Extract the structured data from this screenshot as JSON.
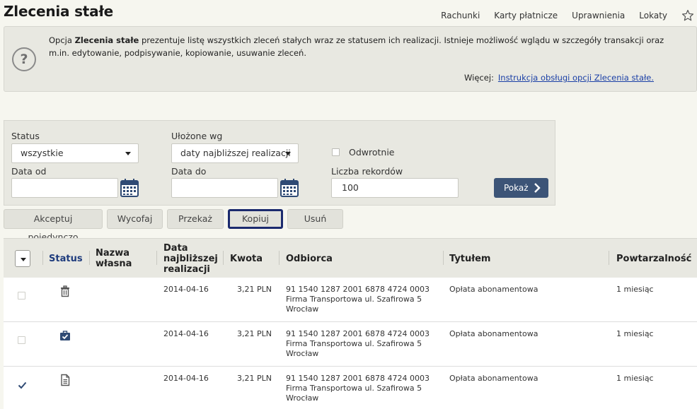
{
  "page": {
    "title": "Zlecenia stałe"
  },
  "nav": {
    "items": [
      "Rachunki",
      "Karty płatnicze",
      "Uprawnienia",
      "Lokaty"
    ],
    "favorite_icon": "star-icon"
  },
  "info": {
    "prefix": "Opcja ",
    "bold": "Zlecenia stałe",
    "text": " prezentuje listę wszystkich zleceń stałych wraz ze statusem ich realizacji. Istnieje możliwość wglądu w szczegóły transakcji oraz m.in. edytowanie, podpisywanie, kopiowanie, usuwanie zleceń.",
    "more_label": "Więcej:",
    "more_link": "Instrukcja obsługi opcji Zlecenia stałe."
  },
  "filters": {
    "status_label": "Status",
    "status_value": "wszystkie",
    "sort_label": "Ułożone wg",
    "sort_value": "daty najbliższej realizacji",
    "reverse_label": "Odwrotnie",
    "date_from_label": "Data od",
    "date_from_value": "",
    "date_to_label": "Data do",
    "date_to_value": "",
    "records_label": "Liczba rekordów",
    "records_value": "100",
    "show_button": "Pokaż"
  },
  "actions": [
    "Akceptuj pojedynczo",
    "Wycofaj",
    "Przekaż",
    "Kopiuj",
    "Usuń"
  ],
  "table": {
    "headers": {
      "status": "Status",
      "name_1": "Nazwa",
      "name_2": "własna",
      "date_1": "Data",
      "date_2": "najbliższej",
      "date_3": "realizacji",
      "amount": "Kwota",
      "recipient": "Odbiorca",
      "title": "Tytułem",
      "repeat": "Powtarzalność"
    },
    "rows": [
      {
        "checked": false,
        "status_icon": "trash-icon",
        "name": "",
        "date": "2014-04-16",
        "amount": "3,21 PLN",
        "account": "91 1540 1287 2001 6878 4724 0003",
        "addr1": "Firma Transportowa ul. Szafirowa 5",
        "addr2": "Wrocław",
        "title": "Opłata abonamentowa",
        "repeat": "1 miesiąc"
      },
      {
        "checked": false,
        "status_icon": "clipboard-check-icon",
        "name": "",
        "date": "2014-04-16",
        "amount": "3,21 PLN",
        "account": "91 1540 1287 2001 6878 4724 0003",
        "addr1": "Firma Transportowa ul. Szafirowa 5",
        "addr2": "Wrocław",
        "title": "Opłata abonamentowa",
        "repeat": "1 miesiąc"
      },
      {
        "checked": true,
        "status_icon": "document-icon",
        "name": "",
        "date": "2014-04-16",
        "amount": "3,21 PLN",
        "account": "91 1540 1287 2001 6878 4724 0003",
        "addr1": "Firma Transportowa ul. Szafirowa 5",
        "addr2": "Wrocław",
        "title": "Opłata abonamentowa",
        "repeat": "1 miesiąc"
      }
    ]
  }
}
